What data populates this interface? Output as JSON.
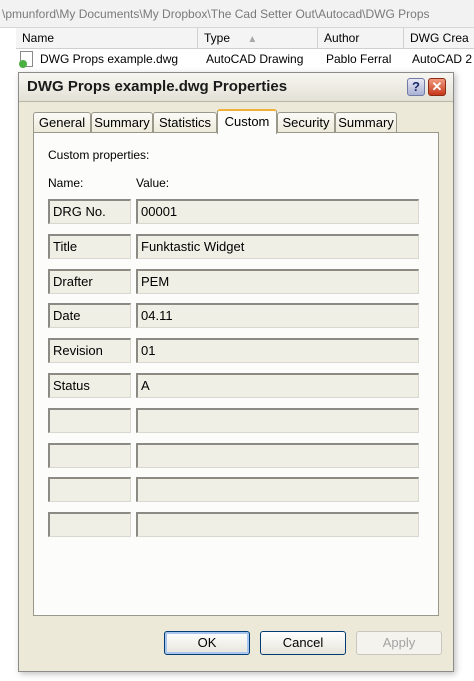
{
  "explorer": {
    "path": "\\pmunford\\My Documents\\My Dropbox\\The Cad Setter Out\\Autocad\\DWG Props",
    "columns": [
      "Name",
      "Type",
      "Author",
      "DWG Crea"
    ],
    "file": {
      "name": "DWG Props example.dwg",
      "type": "AutoCAD Drawing",
      "author": "Pablo Ferral",
      "created": "AutoCAD 2"
    }
  },
  "dialog": {
    "title": "DWG Props example.dwg Properties",
    "help_label": "?",
    "close_label": "✕",
    "tabs": [
      "General",
      "Summary",
      "Statistics",
      "Custom",
      "Security",
      "Summary"
    ],
    "active_tab": "Custom",
    "custom": {
      "heading": "Custom properties:",
      "name_header": "Name:",
      "value_header": "Value:",
      "rows": [
        {
          "name": "DRG No.",
          "value": "00001"
        },
        {
          "name": "Title",
          "value": "Funktastic Widget"
        },
        {
          "name": "Drafter",
          "value": "PEM"
        },
        {
          "name": "Date",
          "value": "04.11"
        },
        {
          "name": "Revision",
          "value": "01"
        },
        {
          "name": "Status",
          "value": "A"
        },
        {
          "name": "",
          "value": ""
        },
        {
          "name": "",
          "value": ""
        },
        {
          "name": "",
          "value": ""
        },
        {
          "name": "",
          "value": ""
        }
      ]
    },
    "buttons": {
      "ok": "OK",
      "cancel": "Cancel",
      "apply": "Apply"
    }
  }
}
